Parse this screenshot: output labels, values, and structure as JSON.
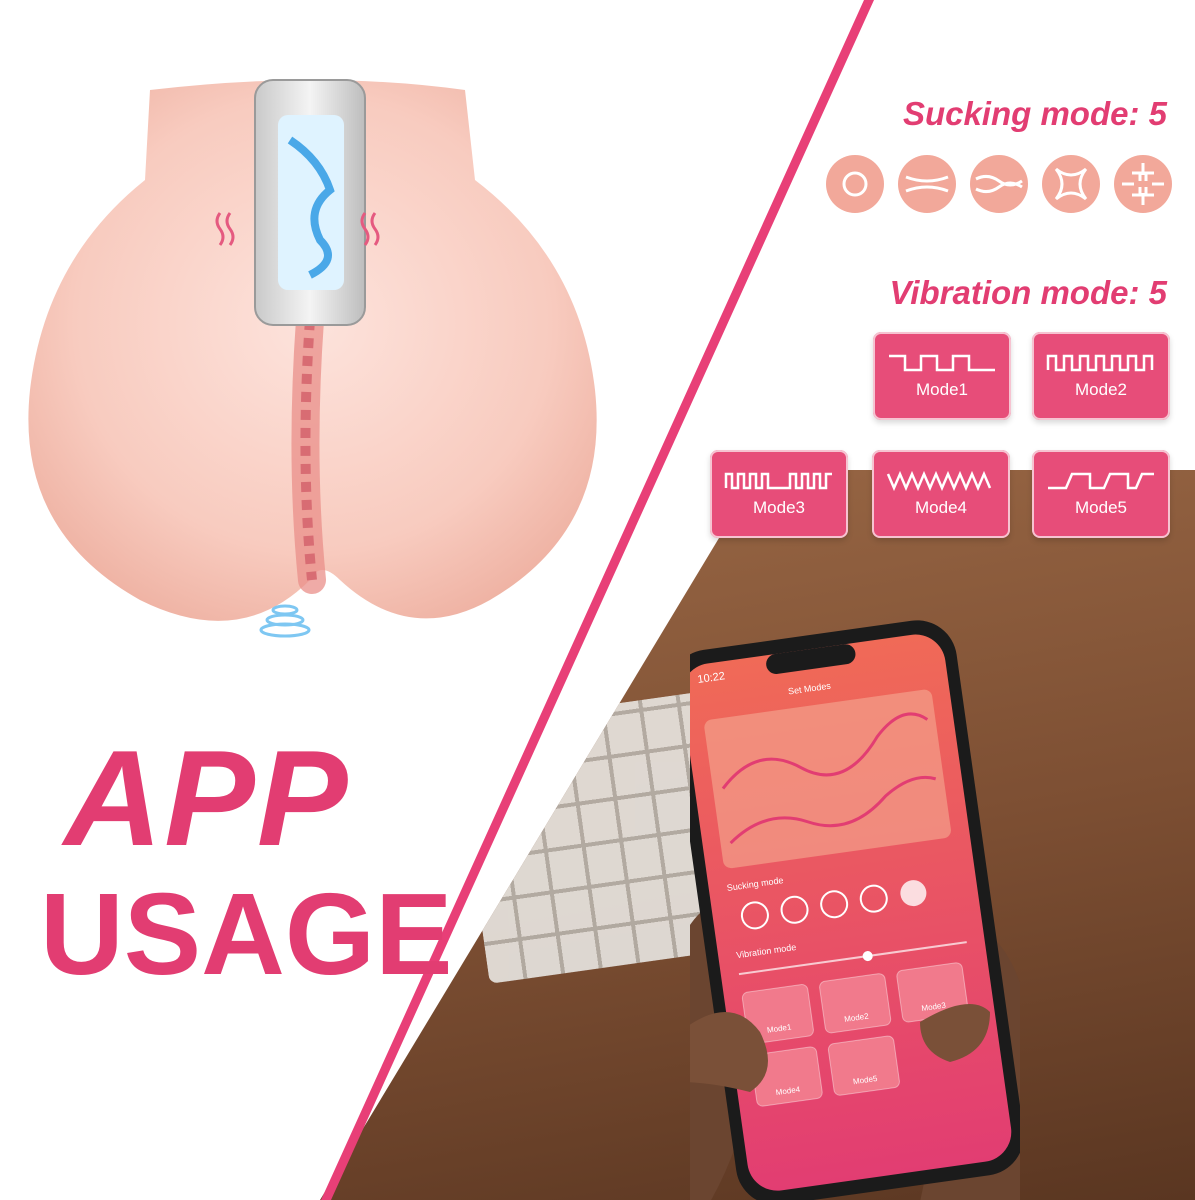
{
  "headline": {
    "line1": "APP",
    "line2": "USAGE"
  },
  "sucking": {
    "title": "Sucking mode: 5",
    "icons": [
      "ring-icon",
      "wave-ball-icon",
      "double-wave-icon",
      "cross-petal-icon",
      "maze-icon"
    ]
  },
  "vibration": {
    "title": "Vibration mode: 5",
    "modes": [
      {
        "label": "Mode1",
        "icon": "square-wave-icon"
      },
      {
        "label": "Mode2",
        "icon": "dense-square-wave-icon"
      },
      {
        "label": "Mode3",
        "icon": "burst-square-wave-icon"
      },
      {
        "label": "Mode4",
        "icon": "zigzag-wave-icon"
      },
      {
        "label": "Mode5",
        "icon": "step-wave-icon"
      }
    ]
  },
  "phone": {
    "time": "10:22",
    "screen_title": "Set Modes",
    "sucking_label": "Sucking mode",
    "vibration_label": "Vibration mode",
    "modes": [
      "Mode1",
      "Mode2",
      "Mode3",
      "Mode4",
      "Mode5"
    ]
  },
  "colors": {
    "accent": "#e23d72",
    "tile": "#e74d79",
    "suck_icon": "#f2a89a"
  }
}
